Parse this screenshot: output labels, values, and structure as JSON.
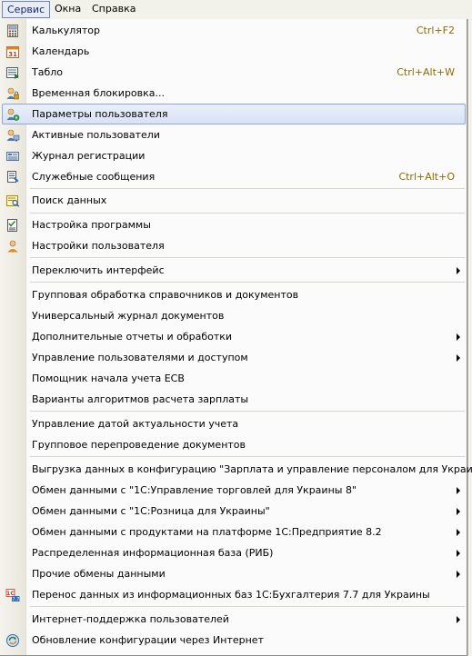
{
  "menubar": {
    "items": [
      {
        "label": "Сервис"
      },
      {
        "label": "Окна"
      },
      {
        "label": "Справка"
      }
    ]
  },
  "menu": {
    "items": [
      {
        "label": "Калькулятор",
        "shortcut": "Ctrl+F2",
        "icon": "calculator-icon"
      },
      {
        "label": "Календарь",
        "icon": "calendar-icon"
      },
      {
        "label": "Табло",
        "shortcut": "Ctrl+Alt+W",
        "icon": "table-icon"
      },
      {
        "label": "Временная блокировка...",
        "icon": "lock-user-icon"
      },
      {
        "label": "Параметры пользователя",
        "icon": "user-settings-icon"
      },
      {
        "label": "Активные пользователи",
        "icon": "active-users-icon"
      },
      {
        "label": "Журнал регистрации",
        "icon": "log-icon"
      },
      {
        "label": "Служебные сообщения",
        "shortcut": "Ctrl+Alt+O",
        "icon": "messages-icon"
      },
      {
        "label": "Поиск данных",
        "icon": "search-data-icon"
      },
      {
        "label": "Настройка программы",
        "icon": "settings-doc-icon"
      },
      {
        "label": "Настройки пользователя",
        "icon": "user-icon"
      },
      {
        "label": "Переключить интерфейс"
      },
      {
        "label": "Групповая обработка справочников и документов"
      },
      {
        "label": "Универсальный журнал документов"
      },
      {
        "label": "Дополнительные отчеты и обработки"
      },
      {
        "label": "Управление пользователями и доступом"
      },
      {
        "label": "Помощник начала учета ЕСВ"
      },
      {
        "label": "Варианты алгоритмов расчета зарплаты"
      },
      {
        "label": "Управление датой актуальности учета"
      },
      {
        "label": "Групповое перепроведение документов"
      },
      {
        "label": "Выгрузка данных в конфигурацию \"Зарплата и управление персоналом для Украины\""
      },
      {
        "label": "Обмен данными с \"1С:Управление торговлей для Украины 8\""
      },
      {
        "label": "Обмен данными с \"1С:Розница для Украины\""
      },
      {
        "label": "Обмен данными с продуктами на платформе 1С:Предприятие 8.2"
      },
      {
        "label": "Распределенная информационная база (РИБ)"
      },
      {
        "label": "Прочие обмены данными"
      },
      {
        "label": "Перенос данных из информационных баз 1С:Бухгалтерия 7.7 для Украины",
        "icon": "transfer-icon"
      },
      {
        "label": "Интернет-поддержка пользователей"
      },
      {
        "label": "Обновление конфигурации через Интернет",
        "icon": "update-icon"
      }
    ]
  }
}
